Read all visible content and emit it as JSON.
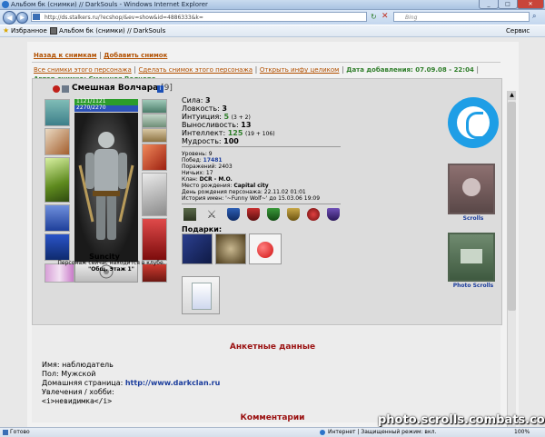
{
  "window": {
    "title": "Альбом бк (снимки) // DarkSouls - Windows Internet Explorer",
    "address": "http://ds.stalkers.ru/?ecshop/&ev=show&id=4886333&k=",
    "search_placeholder": "Bing",
    "favorites_label": "Избранное",
    "tab_label": "Альбом бк (снимки) // DarkSouls",
    "service_label": "Сервис",
    "status_left": "Готово",
    "status_zone": "Интернет | Защищенный режим: вкл.",
    "zoom": "100%"
  },
  "page": {
    "top_links": {
      "back": "Назад к снимкам",
      "add": "Добавить снимок"
    },
    "info_links": {
      "all": "Все снимки этого персонажа",
      "make": "Сделать снимок этого персонажа",
      "open": "Открыть инфу целиком",
      "date": "Дата добавления: 07.09.08 - 22:04",
      "author": "Автор снимка: Смешная Волчара"
    },
    "character": {
      "name": "Смешная Волчара",
      "level": "[9]",
      "hp": "1121/1121",
      "mana": "2270/2270",
      "city_name": "Suncity",
      "location_note": "Персонаж сейчас находится в клубе.",
      "location": "\"Общ. Этаж 1\""
    },
    "stats": {
      "str": {
        "label": "Сила:",
        "value": "3"
      },
      "agi": {
        "label": "Ловкость:",
        "value": "3"
      },
      "int": {
        "label": "Интуиция:",
        "value": "5",
        "extra": "(3 + 2)"
      },
      "end": {
        "label": "Выносливость:",
        "value": "13"
      },
      "intel": {
        "label": "Интеллект:",
        "value": "125",
        "extra": "(19 + 106)"
      },
      "wis": {
        "label": "Мудрость:",
        "value": "100"
      }
    },
    "info": {
      "level": "Уровень: 9",
      "wins_label": "Побед:",
      "wins": "17481",
      "losses": "Поражений: 2403",
      "draws": "Ничьих: 17",
      "clan_label": "Клан:",
      "clan": "DCR - M.O.",
      "birthplace_label": "Место рождения:",
      "birthplace": "Capital city",
      "birthday": "День рождения персонажа: 22.11.02 01:01",
      "name_history": "История имен: '~Funny Wolf~' до 15.03.06 19:09"
    },
    "gifts_label": "Подарки:",
    "side_labels": {
      "scrolls": "Scrolls",
      "photo_scrolls": "Photo Scrolls"
    },
    "profile": {
      "heading": "Анкетные данные",
      "name": "Имя: наблюдатель",
      "gender": "Пол: Мужской",
      "homepage_label": "Домашняя страница:",
      "homepage": "http://www.darkclan.ru",
      "hobby": "Увлечения / хобби:",
      "hobby_value": "<i>невидимка</i>"
    },
    "comments_heading": "Комментарии"
  },
  "watermark": "photo.scrolls.combats.com",
  "colors": {
    "link": "#b25000",
    "green": "#2f7e2a",
    "heading": "#9a1010",
    "blue_text": "#1a3c9c"
  }
}
